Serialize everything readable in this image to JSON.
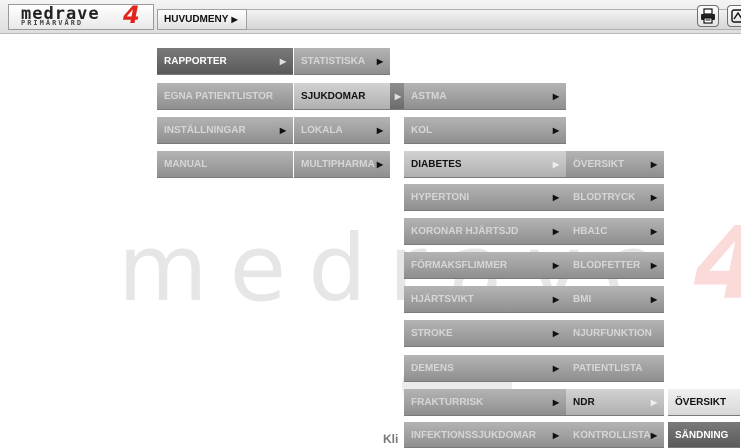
{
  "logo": {
    "word": "medrave",
    "number": "4",
    "tagline": "PRIMÄRVÅRD"
  },
  "topbar": {
    "main_menu_label": "HUVUDMENY",
    "print_icon": "printer-icon",
    "second_icon": "export-icon"
  },
  "watermark": {
    "word": "medrave",
    "number": "4"
  },
  "footer_text": "Kli",
  "menus": {
    "col1": [
      {
        "label": "RAPPORTER",
        "state": "active"
      },
      {
        "label": "EGNA PATIENTLISTOR"
      },
      {
        "label": "INSTÄLLNINGAR"
      },
      {
        "label": "MANUAL"
      }
    ],
    "col2": [
      {
        "label": "STATISTISKA"
      },
      {
        "label": "SJUKDOMAR",
        "state": "active"
      },
      {
        "label": "LOKALA"
      },
      {
        "label": "MULTIPHARMA"
      }
    ],
    "col3": [
      {
        "label": "ASTMA"
      },
      {
        "label": "KOL"
      },
      {
        "label": "DIABETES",
        "state": "active"
      },
      {
        "label": "HYPERTONI"
      },
      {
        "label": "KORONAR HJÄRTSJD"
      },
      {
        "label": "FÖRMAKSFLIMMER"
      },
      {
        "label": "HJÄRTSVIKT"
      },
      {
        "label": "STROKE"
      },
      {
        "label": "DEMENS"
      },
      {
        "label": "FRAKTURRISK"
      },
      {
        "label": "INFEKTIONSSJUKDOMAR"
      }
    ],
    "col4": [
      {
        "label": "ÖVERSIKT"
      },
      {
        "label": "BLODTRYCK"
      },
      {
        "label": "HBA1C"
      },
      {
        "label": "BLODFETTER"
      },
      {
        "label": "BMI"
      },
      {
        "label": "NJURFUNKTION"
      },
      {
        "label": "PATIENTLISTA"
      },
      {
        "label": "NDR",
        "state": "active"
      },
      {
        "label": "KONTROLLISTA"
      }
    ],
    "col5": [
      {
        "label": "ÖVERSIKT"
      },
      {
        "label": "SÄNDNING"
      }
    ]
  }
}
